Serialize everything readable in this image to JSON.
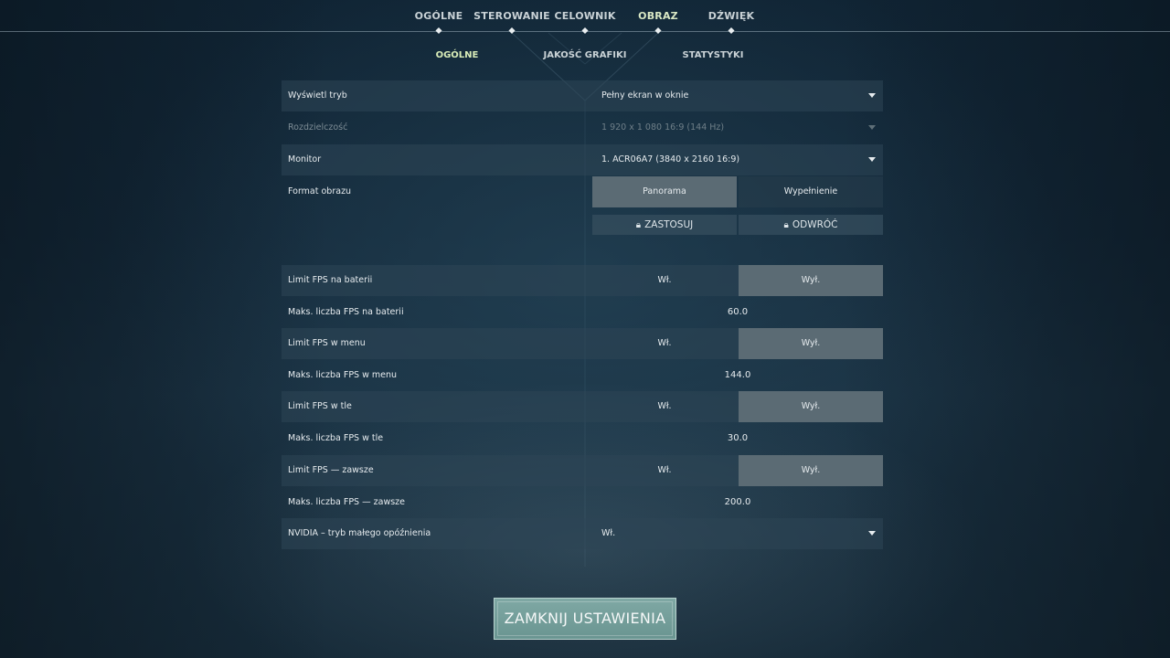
{
  "top_nav": {
    "tabs": [
      {
        "label": "OGÓLNE"
      },
      {
        "label": "STEROWANIE"
      },
      {
        "label": "CELOWNIK"
      },
      {
        "label": "OBRAZ"
      },
      {
        "label": "DŹWIĘK"
      }
    ],
    "active_index": 3
  },
  "sub_nav": {
    "tabs": [
      {
        "label": "OGÓLNE"
      },
      {
        "label": "JAKOŚĆ GRAFIKI"
      },
      {
        "label": "STATYSTYKI"
      }
    ],
    "active_index": 0
  },
  "settings": {
    "display_mode": {
      "label": "Wyświetl tryb",
      "value": "Pełny ekran w oknie"
    },
    "resolution": {
      "label": "Rozdzielczość",
      "value": "1 920 x 1 080 16:9 (144 Hz)"
    },
    "monitor": {
      "label": "Monitor",
      "value": "1. ACR06A7 (3840 x  2160 16:9)"
    },
    "aspect_ratio": {
      "label": "Format obrazu",
      "option1": "Panorama",
      "option2": "Wypełnienie",
      "selected": "option1"
    },
    "apply_label": "ZASTOSUJ",
    "revert_label": "ODWRÓĆ",
    "fps_battery": {
      "label": "Limit FPS na baterii",
      "on": "Wł.",
      "off": "Wył.",
      "selected": "off"
    },
    "fps_battery_max": {
      "label": "Maks. liczba FPS na baterii",
      "value": "60.0"
    },
    "fps_menu": {
      "label": "Limit FPS w menu",
      "on": "Wł.",
      "off": "Wył.",
      "selected": "off"
    },
    "fps_menu_max": {
      "label": "Maks. liczba FPS w menu",
      "value": "144.0"
    },
    "fps_background": {
      "label": "Limit FPS w tle",
      "on": "Wł.",
      "off": "Wył.",
      "selected": "off"
    },
    "fps_background_max": {
      "label": "Maks. liczba FPS w tle",
      "value": "30.0"
    },
    "fps_always": {
      "label": "Limit FPS — zawsze",
      "on": "Wł.",
      "off": "Wył.",
      "selected": "off"
    },
    "fps_always_max": {
      "label": "Maks. liczba FPS — zawsze",
      "value": "200.0"
    },
    "nvidia_low_latency": {
      "label": "NVIDIA – tryb małego opóźnienia",
      "value": "Wł."
    }
  },
  "close_button": {
    "label": "ZAMKNIJ USTAWIENIA"
  },
  "colors": {
    "accent_active_tab": "#d9e8c4",
    "toggle_selected": "#5b6b74",
    "close_button": "#7fa8a4"
  }
}
